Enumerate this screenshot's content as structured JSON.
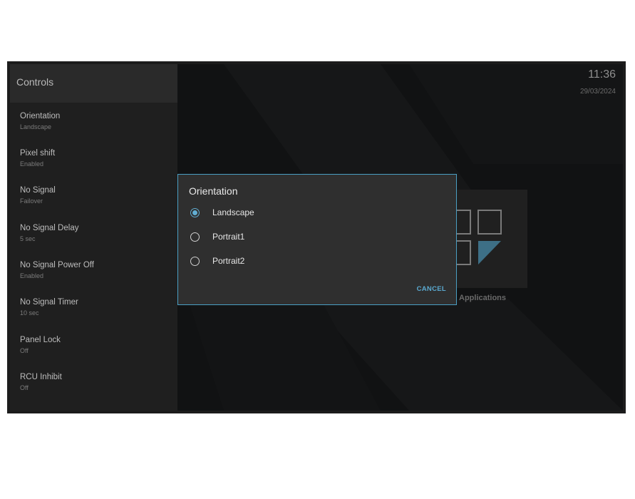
{
  "sidebar": {
    "title": "Controls",
    "items": [
      {
        "label": "Orientation",
        "value": "Landscape"
      },
      {
        "label": "Pixel shift",
        "value": "Enabled"
      },
      {
        "label": "No Signal",
        "value": "Failover"
      },
      {
        "label": "No Signal Delay",
        "value": "5 sec"
      },
      {
        "label": "No Signal Power Off",
        "value": "Enabled"
      },
      {
        "label": "No Signal Timer",
        "value": "10 sec"
      },
      {
        "label": "Panel Lock",
        "value": "Off"
      },
      {
        "label": "RCU Inhibit",
        "value": "Off"
      }
    ]
  },
  "status": {
    "time": "11:36",
    "date": "29/03/2024"
  },
  "launcher": {
    "app_label": "Applications",
    "icon": "apps-grid-icon"
  },
  "dialog": {
    "title": "Orientation",
    "options": [
      {
        "label": "Landscape",
        "selected": true
      },
      {
        "label": "Portrait1",
        "selected": false
      },
      {
        "label": "Portrait2",
        "selected": false
      }
    ],
    "cancel_label": "CANCEL"
  },
  "colors": {
    "accent": "#5aa9d0",
    "dialog_bg": "#2f2f2f",
    "sidebar_bg": "#1f1f1f"
  }
}
